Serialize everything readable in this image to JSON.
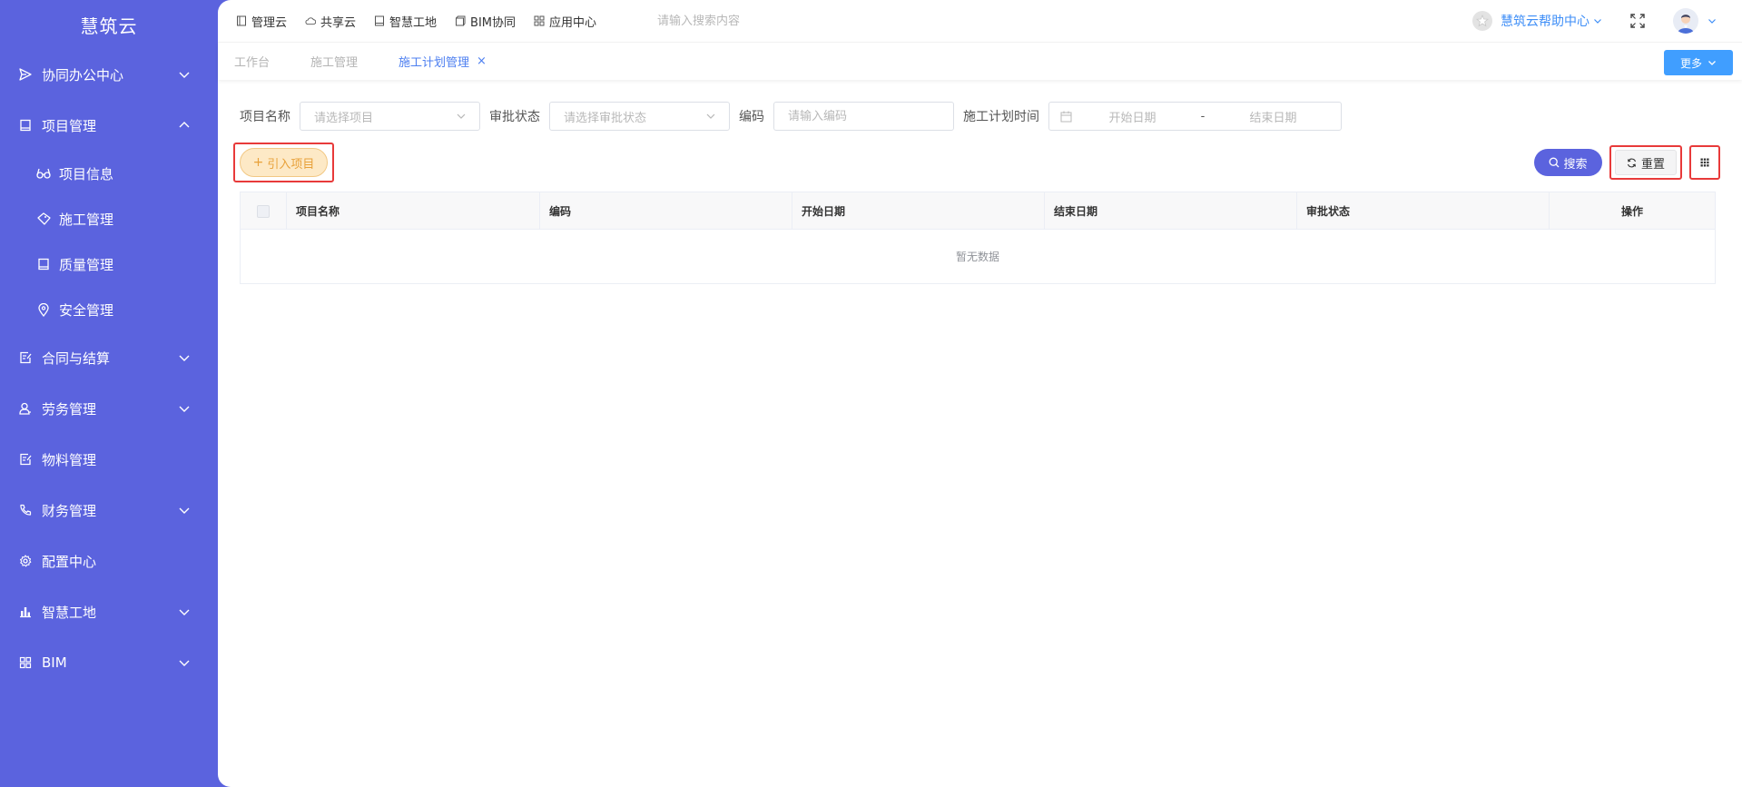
{
  "app": {
    "title": "慧筑云"
  },
  "sidebar": {
    "items": [
      {
        "label": "协同办公中心",
        "icon": "send-icon",
        "arrow": "down"
      },
      {
        "label": "项目管理",
        "icon": "book-icon",
        "arrow": "up"
      },
      {
        "label": "合同与结算",
        "icon": "edit-doc-icon",
        "arrow": "down"
      },
      {
        "label": "劳务管理",
        "icon": "user-icon",
        "arrow": "down"
      },
      {
        "label": "物料管理",
        "icon": "edit-doc-icon",
        "arrow": "none"
      },
      {
        "label": "财务管理",
        "icon": "phone-icon",
        "arrow": "down"
      },
      {
        "label": "配置中心",
        "icon": "gear-icon",
        "arrow": "none"
      },
      {
        "label": "智慧工地",
        "icon": "bar-chart-icon",
        "arrow": "down"
      },
      {
        "label": "BIM",
        "icon": "grid-icon",
        "arrow": "down"
      }
    ],
    "subitems": [
      {
        "label": "项目信息",
        "icon": "glasses-icon"
      },
      {
        "label": "施工管理",
        "icon": "diamond-icon"
      },
      {
        "label": "质量管理",
        "icon": "book-icon"
      },
      {
        "label": "安全管理",
        "icon": "location-icon"
      }
    ]
  },
  "topbar": {
    "nav": [
      {
        "label": "管理云",
        "icon": "book-icon"
      },
      {
        "label": "共享云",
        "icon": "cloud-icon"
      },
      {
        "label": "智慧工地",
        "icon": "book-icon"
      },
      {
        "label": "BIM协同",
        "icon": "cube-icon"
      },
      {
        "label": "应用中心",
        "icon": "grid-icon"
      }
    ],
    "search_placeholder": "请输入搜索内容",
    "help_label": "慧筑云帮助中心"
  },
  "tabs": {
    "items": [
      "工作台",
      "施工管理",
      "施工计划管理"
    ],
    "active_index": 2,
    "close_glyph": "×",
    "more_label": "更多"
  },
  "filters": {
    "project_name_label": "项目名称",
    "project_name_placeholder": "请选择项目",
    "approval_label": "审批状态",
    "approval_placeholder": "请选择审批状态",
    "code_label": "编码",
    "code_placeholder": "请输入编码",
    "time_label": "施工计划时间",
    "start_placeholder": "开始日期",
    "range_separator": "-",
    "end_placeholder": "结束日期"
  },
  "toolbar": {
    "import_label": "引入项目",
    "search_label": "搜索",
    "reset_label": "重置"
  },
  "table": {
    "columns": [
      "项目名称",
      "编码",
      "开始日期",
      "结束日期",
      "审批状态",
      "操作"
    ],
    "empty_text": "暂无数据"
  },
  "colors": {
    "sidebar_bg": "#5b63de",
    "accent_blue": "#409eff",
    "primary_purple": "#5b63de",
    "highlight_red": "#e83a3a",
    "import_orange": "#e8a13a"
  }
}
